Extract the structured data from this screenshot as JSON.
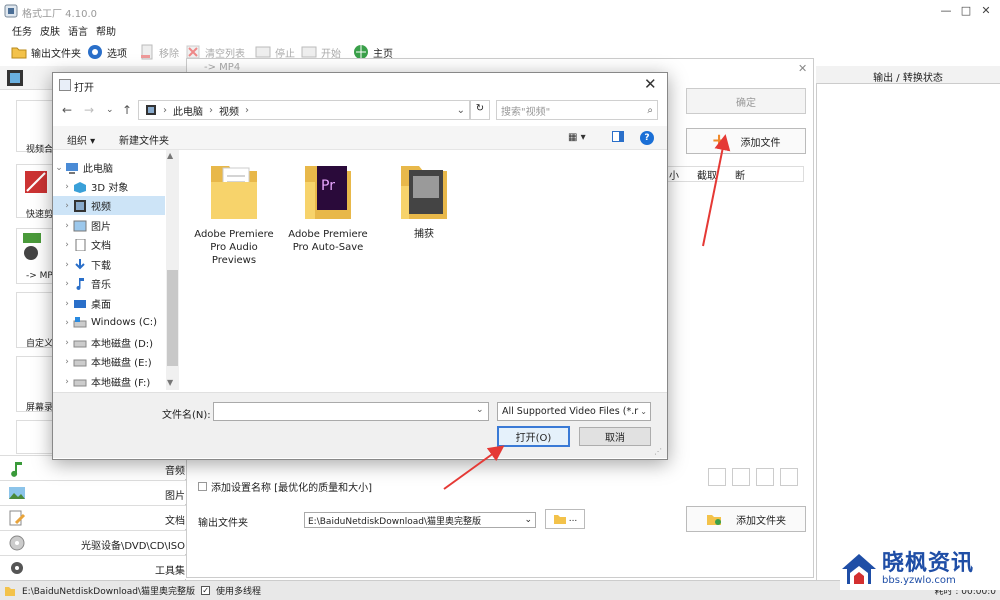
{
  "app": {
    "title": "格式工厂 4.10.0",
    "menu": [
      "任务",
      "皮肤",
      "语言",
      "帮助"
    ],
    "toolbar": {
      "output_folder": "输出文件夹",
      "options": "选项",
      "remove": "移除",
      "clear_list": "清空列表",
      "stop": "停止",
      "start": "开始",
      "home": "主页"
    }
  },
  "left_panel": {
    "tiles": [
      "视频合",
      "快速剪",
      "-> MP",
      "自定义",
      "屏幕录"
    ],
    "categories": [
      "音频",
      "图片",
      "文档",
      "光驱设备\\DVD\\CD\\ISO",
      "工具集"
    ]
  },
  "convert_panel": {
    "title": "-> MP4",
    "confirm_label": "确定",
    "add_file_label": "添加文件",
    "columns": [
      "小",
      "截取",
      "断"
    ],
    "add_setting_name": "添加设置名称 [最优化的质量和大小]",
    "output_folder_label": "输出文件夹",
    "output_folder_value": "E:\\BaiduNetdiskDownload\\猫里奥完整版",
    "folder_btn_dots": "...",
    "add_folder_label": "添加文件夹"
  },
  "right_panel": {
    "header": "输出 / 转换状态"
  },
  "status_bar": {
    "path": "E:\\BaiduNetdiskDownload\\猫里奥完整版",
    "multithread": "使用多线程",
    "elapsed": "耗时 : 00:00:0"
  },
  "watermark": {
    "title": "晓枫资讯",
    "url": "bbs.yzwlo.com"
  },
  "dialog": {
    "title": "打开",
    "breadcrumb": [
      "此电脑",
      "视频"
    ],
    "search_placeholder": "搜索\"视频\"",
    "organize": "组织 ▾",
    "new_folder": "新建文件夹",
    "tree": [
      {
        "label": "此电脑",
        "expanded": true
      },
      {
        "label": "3D 对象"
      },
      {
        "label": "视频",
        "selected": true
      },
      {
        "label": "图片"
      },
      {
        "label": "文档"
      },
      {
        "label": "下载"
      },
      {
        "label": "音乐"
      },
      {
        "label": "桌面"
      },
      {
        "label": "Windows (C:)"
      },
      {
        "label": "本地磁盘 (D:)"
      },
      {
        "label": "本地磁盘 (E:)"
      },
      {
        "label": "本地磁盘 (F:)"
      }
    ],
    "files": [
      {
        "name": "Adobe Premiere Pro Audio Previews",
        "icon": "folder-docs-icon"
      },
      {
        "name": "Adobe Premiere Pro Auto-Save",
        "icon": "folder-premiere-icon"
      },
      {
        "name": "捕获",
        "icon": "folder-capture-icon"
      }
    ],
    "filename_label": "文件名(N):",
    "filename_value": "",
    "filetype_value": "All Supported Video Files (*.r",
    "open_label": "打开(O)",
    "cancel_label": "取消"
  },
  "colors": {
    "accent": "#3a7ad6",
    "arrow": "#e53935",
    "plus": "#f08a2a",
    "watermark": "#1f4ea6"
  }
}
